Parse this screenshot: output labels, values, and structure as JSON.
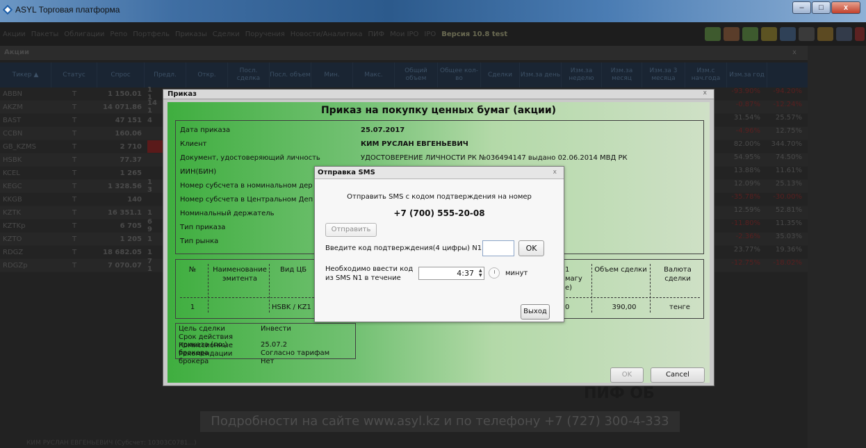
{
  "window": {
    "title": "ASYL Торговая платформа",
    "minimize": "–",
    "maximize": "□",
    "close": "x"
  },
  "menu": {
    "items": [
      "Акции",
      "Пакеты",
      "Облигации",
      "Репо",
      "Портфель",
      "Приказы",
      "Сделки",
      "Поручения",
      "Новости/Аналитика",
      "ПИФ",
      "Мои IPO",
      "IPO"
    ],
    "version": "Версия 10.8 test"
  },
  "section": {
    "title": "Акции",
    "close": "x"
  },
  "table": {
    "headers": [
      "Тикер ▲",
      "Статус",
      "Спрос",
      "Предл.",
      "Откр.",
      "Посл. сделка",
      "Посл. объем",
      "Мин.",
      "Макс.",
      "Общий объем",
      "Общее кол-во",
      "Сделки",
      "Изм.за день",
      "Изм.за неделю",
      "Изм.за месяц",
      "Изм.за 3 месяца",
      "Изм.с нач.года",
      "Изм.за год"
    ],
    "rows": [
      {
        "ticker": "ABBN",
        "status": "T",
        "bid": "1 150.01",
        "bid2": "1 1",
        "p1": "-93.90%",
        "p2": "-94.20%"
      },
      {
        "ticker": "AKZM",
        "status": "T",
        "bid": "14 071.86",
        "bid2": "14 1",
        "p1": "-0.87%",
        "p2": "-12.24%"
      },
      {
        "ticker": "BAST",
        "status": "T",
        "bid": "47 151",
        "bid2": "4",
        "p1": "31.54%",
        "p2": "25.57%"
      },
      {
        "ticker": "CCBN",
        "status": "T",
        "bid": "160.06",
        "bid2": "",
        "p1": "-4.96%",
        "p2": "12.75%"
      },
      {
        "ticker": "GB_KZMS",
        "status": "T",
        "bid": "2 710",
        "bid2": "",
        "p1": "82.00%",
        "p2": "344.70%"
      },
      {
        "ticker": "HSBK",
        "status": "T",
        "bid": "77.37",
        "bid2": "",
        "p1": "54.95%",
        "p2": "74.50%"
      },
      {
        "ticker": "KCEL",
        "status": "T",
        "bid": "1 265",
        "bid2": "",
        "p1": "13.88%",
        "p2": "11.61%"
      },
      {
        "ticker": "KEGC",
        "status": "T",
        "bid": "1 328.56",
        "bid2": "1 3",
        "p1": "12.09%",
        "p2": "25.13%"
      },
      {
        "ticker": "KKGB",
        "status": "T",
        "bid": "140",
        "bid2": "",
        "p1": "-35.78%",
        "p2": "-30.00%"
      },
      {
        "ticker": "KZTK",
        "status": "T",
        "bid": "16 351.1",
        "bid2": "1",
        "p1": "12.59%",
        "p2": "52.81%"
      },
      {
        "ticker": "KZTKp",
        "status": "T",
        "bid": "6 705",
        "bid2": "6 9",
        "p1": "-11.80%",
        "p2": "11.35%"
      },
      {
        "ticker": "KZTO",
        "status": "T",
        "bid": "1 205",
        "bid2": "1",
        "p1": "-2.36%",
        "p2": "35.03%"
      },
      {
        "ticker": "RDGZ",
        "status": "T",
        "bid": "18 682.05",
        "bid2": "1",
        "p1": "23.77%",
        "p2": "19.36%"
      },
      {
        "ticker": "RDGZp",
        "status": "T",
        "bid": "7 070.07",
        "bid2": "7 1",
        "p1": "-12.75%",
        "p2": "-18.02%"
      }
    ]
  },
  "promo": {
    "text": "Подробности на сайте www.asyl.kz и по телефону +7 (727) 300-4-333",
    "partial": "ПИФ ОБ"
  },
  "statusbar": {
    "text": "КИМ РУСЛАН ЕВГЕНЬЕВИЧ (Субсчет: 10303C0781...)"
  },
  "order": {
    "dialog_title": "Приказ",
    "close": "x",
    "heading": "Приказ на покупку ценных бумаг (акции)",
    "fields": [
      {
        "label": "Дата приказа",
        "value": "25.07.2017"
      },
      {
        "label": "Клиент",
        "value": "КИМ РУСЛАН ЕВГЕНЬЕВИЧ"
      },
      {
        "label": "Документ, удостоверяющий личность",
        "value": "УДОСТОВЕРЕНИЕ ЛИЧНОСТИ РК №036494147 выдано 02.06.2014 МВД РК"
      },
      {
        "label": "ИИН(БИН)",
        "value": ""
      },
      {
        "label": "Номер субсчета в номинальном дер",
        "value": ""
      },
      {
        "label": "Номер субсчета в Центральном Деп",
        "value": ""
      },
      {
        "label": "Номинальный держатель",
        "value": ""
      },
      {
        "label": "Тип приказа",
        "value": ""
      },
      {
        "label": "Тип рынка",
        "value": ""
      }
    ],
    "grid": {
      "h_num": "№",
      "h_issuer": "Наименование эмитента",
      "h_type": "Вид ЦБ",
      "h_price": "1 магу е)",
      "h_volume": "Объем сделки",
      "h_currency": "Валюта сделки",
      "r_num": "1",
      "r_type": "HSBK / KZ1",
      "r_price": "0",
      "r_volume": "390,00",
      "r_currency": "тенге"
    },
    "extra": [
      {
        "label": "Цель сделки",
        "value": "Инвести"
      },
      {
        "label": "Срок действия приказа (по:)",
        "value": "25.07.2"
      },
      {
        "label": "Комиссионные брокера",
        "value": "Согласно тарифам"
      },
      {
        "label": "Рекомендации брокера",
        "value": "Нет"
      }
    ],
    "ok": "OK",
    "cancel": "Cancel"
  },
  "sms": {
    "title": "Отправка SMS",
    "close": "x",
    "text": "Отправить SMS с кодом подтверждения на номер",
    "phone": "+7 (700) 555-20-08",
    "send": "Отправить",
    "code_label": "Введите код подтверждения(4 цифры) N1",
    "code_value": "",
    "ok": "OK",
    "need_label_1": "Необходимо ввести код",
    "need_label_2": "из SMS N1 в течение",
    "timer": "4:37",
    "minutes": "минут",
    "exit": "Выход"
  },
  "colors": {
    "accent_green": "#3fae3f",
    "title_blue": "#2c5a8c",
    "close_red": "#c2412c"
  }
}
